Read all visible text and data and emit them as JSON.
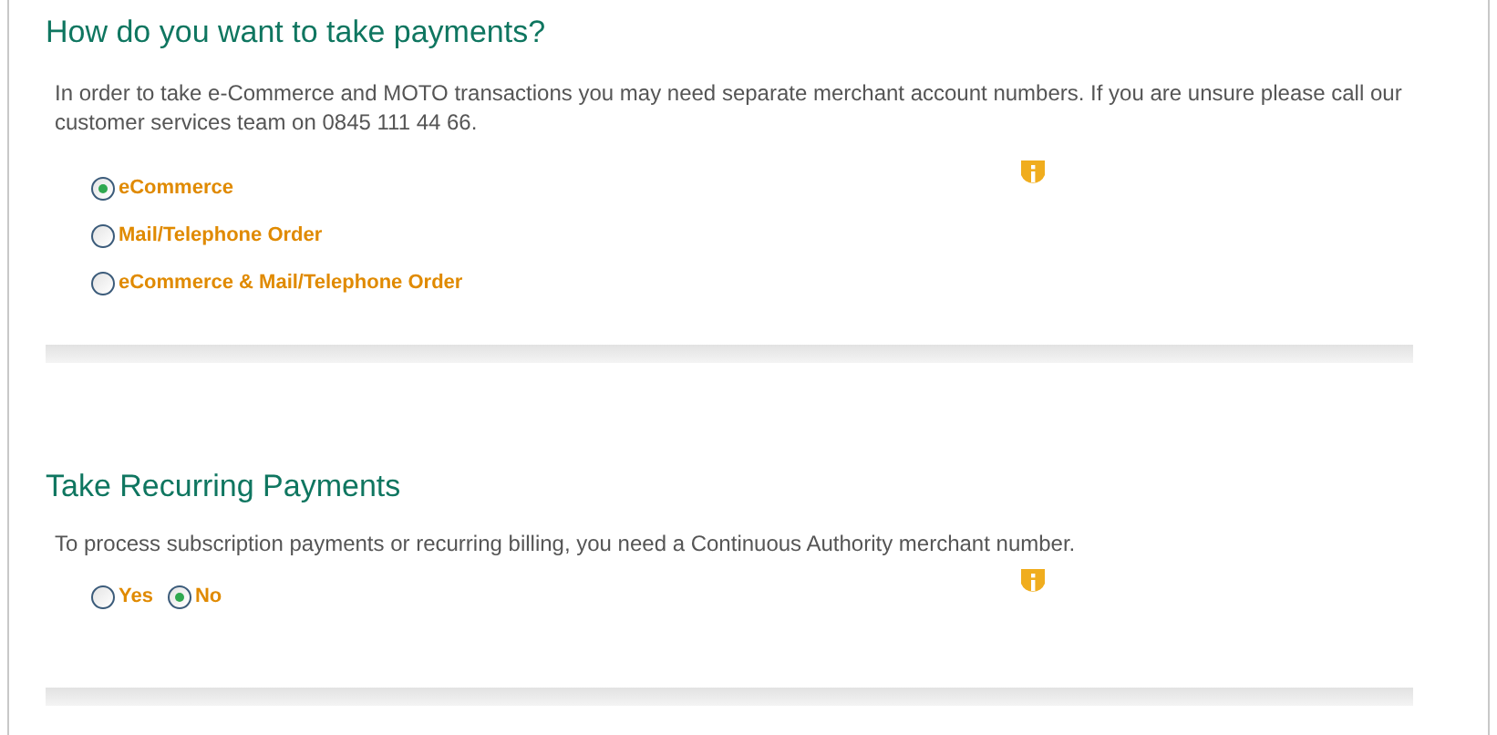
{
  "sections": [
    {
      "heading": "How do you want to take payments?",
      "text": "In order to take e-Commerce and MOTO transactions you may need separate merchant account numbers. If you are unsure please call our customer services team on 0845 111 44 66.",
      "kind": "stacked",
      "options": [
        {
          "label": "eCommerce",
          "selected": true
        },
        {
          "label": "Mail/Telephone Order",
          "selected": false
        },
        {
          "label": "eCommerce & Mail/Telephone Order",
          "selected": false
        }
      ]
    },
    {
      "heading": "Take Recurring Payments",
      "text": "To process subscription payments or recurring billing, you need a Continuous Authority merchant number.",
      "kind": "inline",
      "options": [
        {
          "label": "Yes",
          "selected": false
        },
        {
          "label": "No",
          "selected": true
        }
      ]
    }
  ]
}
